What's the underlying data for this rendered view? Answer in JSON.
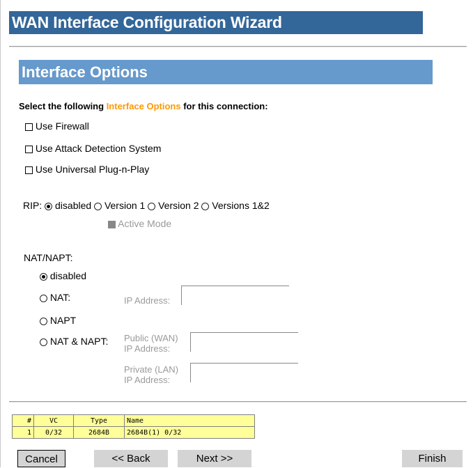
{
  "wizard": {
    "title": "WAN Interface Configuration Wizard"
  },
  "section": {
    "title": "Interface Options"
  },
  "instructions": {
    "prefix": "Select the following ",
    "highlight": "Interface Options",
    "suffix": " for this connection:"
  },
  "options": {
    "firewall": "Use Firewall",
    "attack_detection": "Use Attack Detection System",
    "upnp": "Use Universal Plug-n-Play"
  },
  "rip": {
    "label": "RIP:",
    "disabled": "disabled",
    "v1": "Version 1",
    "v2": "Version 2",
    "v12": "Versions 1&2",
    "active_mode": "Active Mode"
  },
  "nat": {
    "label": "NAT/NAPT:",
    "disabled": "disabled",
    "nat": "NAT:",
    "napt": "NAPT",
    "nat_napt": "NAT & NAPT:",
    "ip_address": "IP Address:",
    "public_wan": "Public (WAN)",
    "private_lan": "Private (LAN)",
    "ip_address2": "IP Address:",
    "ip_address3": "IP Address:"
  },
  "vc_table": {
    "headers": [
      "#",
      "VC",
      "Type",
      "Name"
    ],
    "rows": [
      [
        "1",
        "0/32",
        "2684B",
        "2684B(1) 0/32"
      ]
    ]
  },
  "buttons": {
    "cancel": "Cancel",
    "back": "<< Back",
    "next": "Next >>",
    "finish": "Finish"
  },
  "colors": {
    "title_bar": "#336699",
    "section_bar": "#6699cc",
    "highlight": "#ff9900",
    "table_bg": "#ffff99"
  }
}
